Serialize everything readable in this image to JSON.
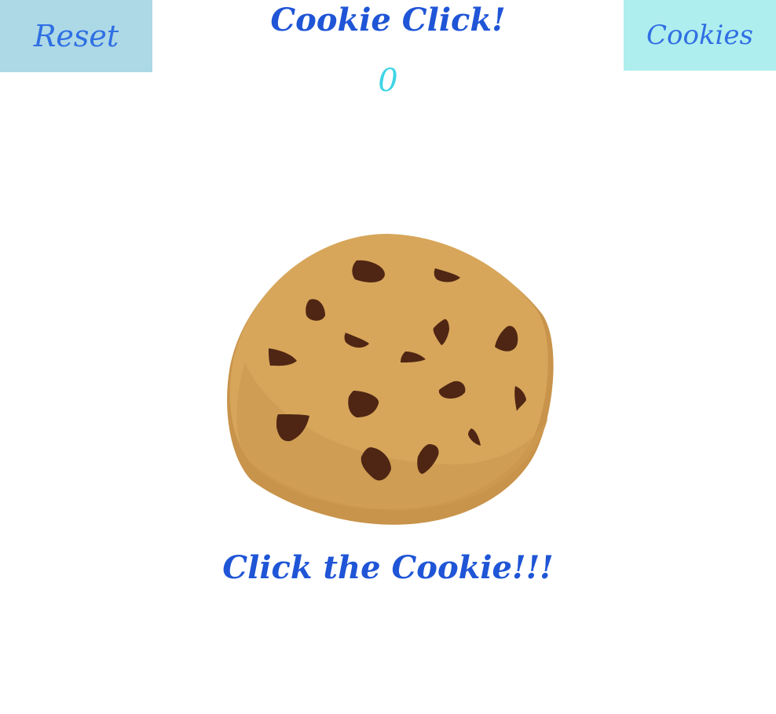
{
  "header": {
    "reset_label": "Reset",
    "title": "Cookie Click!",
    "cookies_label": "Cookies"
  },
  "counter": {
    "value": "0"
  },
  "cookie": {
    "caption": "Click the Cookie!!!",
    "colors": {
      "dough": "#d7a65a",
      "dough_shadow": "#c8934a",
      "chip": "#4f2614"
    }
  },
  "colors": {
    "reset_button_bg": "#add8e6",
    "cookies_button_bg": "#afeeee",
    "button_text": "#2f6fe3",
    "title_text": "#1f55d6",
    "counter_text": "#3fd4e6"
  }
}
